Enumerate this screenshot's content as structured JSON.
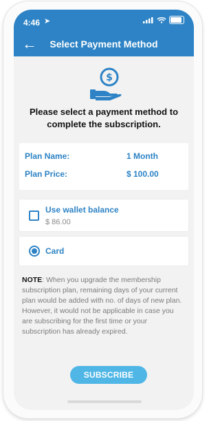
{
  "status_bar": {
    "time": "4:46",
    "location_symbol": "➤"
  },
  "header": {
    "title": "Select Payment Method",
    "back_icon": "back-arrow-icon"
  },
  "intro": {
    "text": "Please select a payment method to complete the subscription."
  },
  "plan": {
    "name_label": "Plan Name:",
    "name_value": "1 Month",
    "price_label": "Plan Price:",
    "price_value": "$ 100.00"
  },
  "options": [
    {
      "label": "Use wallet balance",
      "sub": "$ 86.00",
      "checked": false
    },
    {
      "label": "Card",
      "selected": true
    }
  ],
  "note": {
    "prefix": "NOTE",
    "text": ": When you upgrade the membership subscription plan, remaining days of your current plan would be added with no. of days of new plan. However, it would not be applicable in case you are subscribing for the first time or your subscription has already expired."
  },
  "actions": {
    "subscribe_label": "SUBSCRIBE"
  },
  "colors": {
    "primary": "#2d83c5",
    "button": "#4fb6e6"
  }
}
